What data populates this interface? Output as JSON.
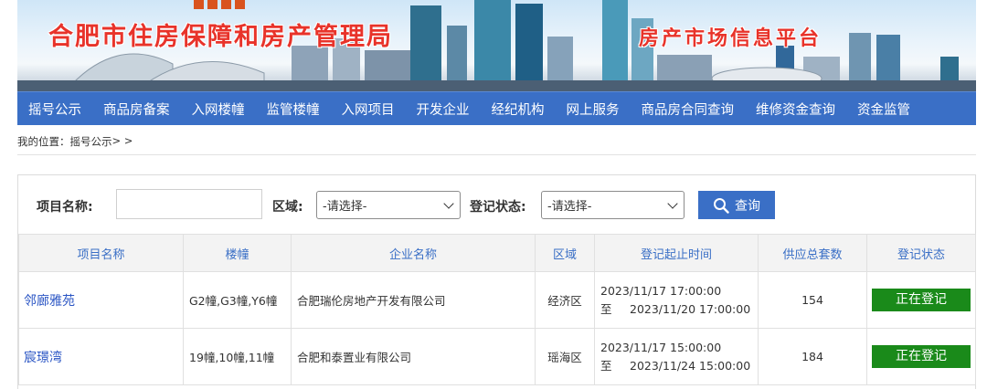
{
  "header": {
    "org_title": "合肥市住房保障和房产管理局",
    "platform_title": "房产市场信息平台"
  },
  "nav": {
    "items": [
      "摇号公示",
      "商品房备案",
      "入网楼幢",
      "监管楼幢",
      "入网项目",
      "开发企业",
      "经纪机构",
      "网上服务",
      "商品房合同查询",
      "维修资金查询",
      "资金监管"
    ]
  },
  "breadcrumb": {
    "prefix": "我的位置：",
    "current": "摇号公示",
    "suffix": " > >"
  },
  "search": {
    "project_label": "项目名称:",
    "project_value": "",
    "area_label": "区域:",
    "area_selected": "-请选择-",
    "status_label": "登记状态:",
    "status_selected": "-请选择-",
    "search_button": "查询"
  },
  "table": {
    "headers": [
      "项目名称",
      "楼幢",
      "企业名称",
      "区域",
      "登记起止时间",
      "供应总套数",
      "登记状态"
    ],
    "rows": [
      {
        "project": "邻廊雅苑",
        "buildings": "G2幢,G3幢,Y6幢",
        "company": "合肥瑞伦房地产开发有限公司",
        "area": "经济区",
        "start": "2023/11/17 17:00:00",
        "to": "至",
        "end": "2023/11/20 17:00:00",
        "units": "154",
        "status": "正在登记"
      },
      {
        "project": "宸璟湾",
        "buildings": "19幢,10幢,11幢",
        "company": "合肥和泰置业有限公司",
        "area": "瑶海区",
        "start": "2023/11/17 15:00:00",
        "to": "至",
        "end": "2023/11/24 15:00:00",
        "units": "184",
        "status": "正在登记"
      }
    ]
  },
  "colors": {
    "nav_bg": "#3a6fc6",
    "title_red": "#e8332a",
    "status_green": "#1a8a1a",
    "link_blue": "#2a55c4"
  }
}
